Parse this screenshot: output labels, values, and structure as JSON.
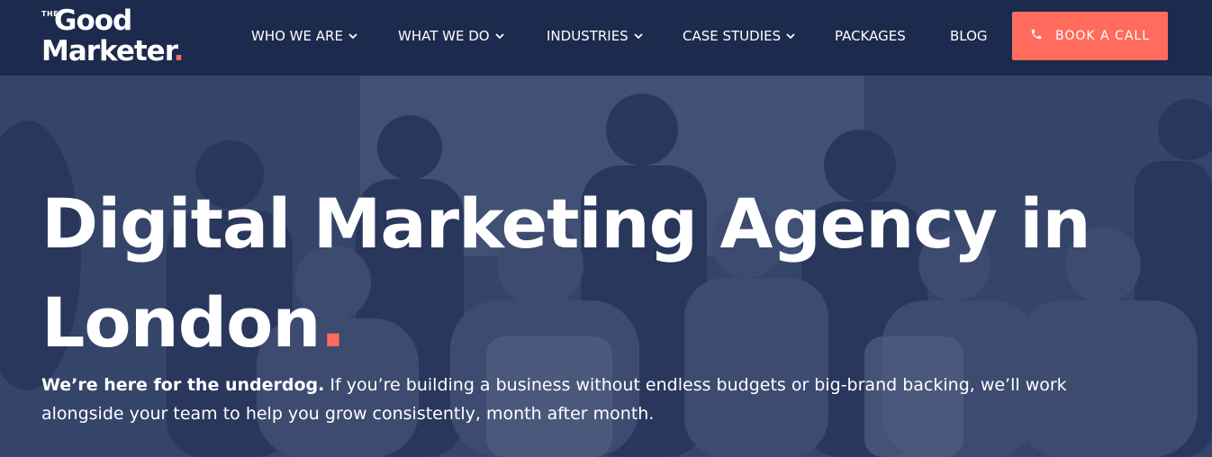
{
  "brand": {
    "the": "THE",
    "line1": "Good",
    "line2": "Marketer",
    "dot": "."
  },
  "nav": {
    "items": [
      {
        "label": "WHO WE ARE",
        "has_dropdown": true
      },
      {
        "label": "WHAT WE DO",
        "has_dropdown": true
      },
      {
        "label": "INDUSTRIES",
        "has_dropdown": true
      },
      {
        "label": "CASE STUDIES",
        "has_dropdown": true
      },
      {
        "label": "PACKAGES",
        "has_dropdown": false
      },
      {
        "label": "BLOG",
        "has_dropdown": false
      }
    ],
    "cta": {
      "label": "BOOK A CALL",
      "icon": "phone-icon"
    }
  },
  "hero": {
    "headline_line1": "Digital Marketing Agency in",
    "headline_line2": "London",
    "headline_dot": ".",
    "lead_bold": "We’re here for the underdog.",
    "lead_rest": " If you’re building a business without endless budgets or big-brand backing, we’ll work alongside your team to help you grow consistently, month after month.",
    "background": "team-photo"
  },
  "colors": {
    "navy": "#1c2a4d",
    "accent": "#ff6b5c",
    "text": "#ffffff"
  }
}
